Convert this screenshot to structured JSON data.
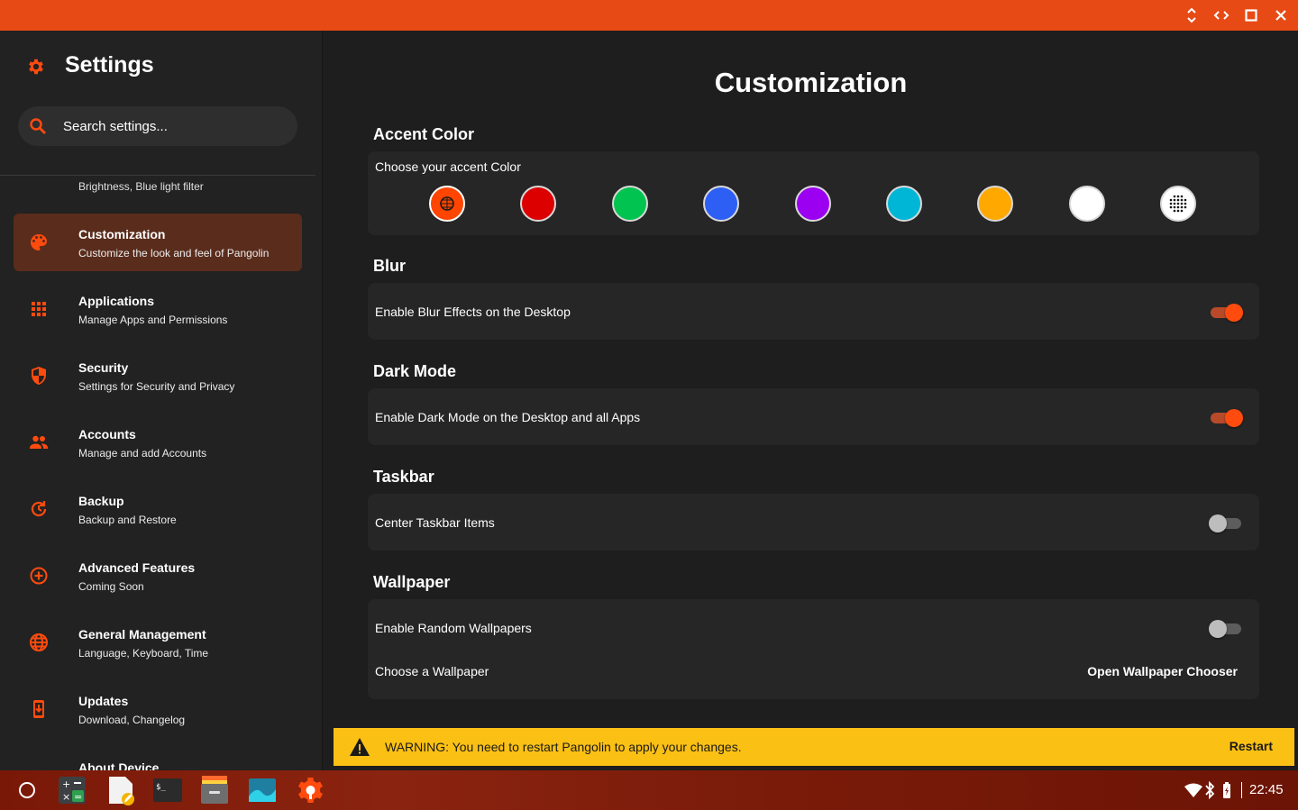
{
  "titlebar": {
    "bg": "#e84a16",
    "buttons": [
      "resize-icon",
      "code-icon",
      "maximize-icon",
      "close-icon"
    ]
  },
  "sidebar": {
    "title": "Settings",
    "search_placeholder": "Search settings...",
    "partial_item_sub": "Brightness, Blue light filter",
    "items": [
      {
        "title": "Customization",
        "sub": "Customize the look and feel of Pangolin",
        "icon": "palette-icon",
        "active": true
      },
      {
        "title": "Applications",
        "sub": "Manage Apps and Permissions",
        "icon": "apps-grid-icon"
      },
      {
        "title": "Security",
        "sub": "Settings for Security and Privacy",
        "icon": "shield-icon"
      },
      {
        "title": "Accounts",
        "sub": "Manage and add Accounts",
        "icon": "people-icon"
      },
      {
        "title": "Backup",
        "sub": "Backup and Restore",
        "icon": "backup-restore-icon"
      },
      {
        "title": "Advanced Features",
        "sub": "Coming Soon",
        "icon": "plus-circle-icon"
      },
      {
        "title": "General Management",
        "sub": "Language, Keyboard, Time",
        "icon": "globe-icon"
      },
      {
        "title": "Updates",
        "sub": "Download, Changelog",
        "icon": "system-update-icon"
      },
      {
        "title": "About Device",
        "sub": "",
        "icon": "device-icon"
      }
    ]
  },
  "main": {
    "title": "Customization",
    "accent": {
      "heading": "Accent Color",
      "label": "Choose your accent Color",
      "colors": [
        "#ff4500",
        "#dd0000",
        "#00c44f",
        "#2d5ff5",
        "#9b00f0",
        "#00b6d6",
        "#ffa800",
        "#ffffff",
        "#ffffff"
      ],
      "selected_index": 0
    },
    "blur": {
      "heading": "Blur",
      "label": "Enable Blur Effects on the Desktop",
      "enabled": true
    },
    "dark_mode": {
      "heading": "Dark Mode",
      "label": "Enable Dark Mode on the Desktop and all Apps",
      "enabled": true
    },
    "taskbar": {
      "heading": "Taskbar",
      "label": "Center Taskbar Items",
      "enabled": false
    },
    "wallpaper": {
      "heading": "Wallpaper",
      "random_label": "Enable Random Wallpapers",
      "random_enabled": false,
      "choose_label": "Choose a Wallpaper",
      "chooser_button": "Open Wallpaper Chooser"
    },
    "warning": {
      "text": "WARNING: You need to restart Pangolin to apply your changes.",
      "button": "Restart",
      "bg": "#fbc014"
    }
  },
  "taskbar": {
    "apps": [
      "launcher-icon",
      "calculator-icon",
      "text-editor-icon",
      "terminal-icon",
      "archive-icon",
      "image-viewer-icon",
      "settings-app-icon"
    ],
    "tray": [
      "wifi-icon",
      "bluetooth-icon",
      "battery-icon"
    ],
    "clock": "22:45"
  }
}
